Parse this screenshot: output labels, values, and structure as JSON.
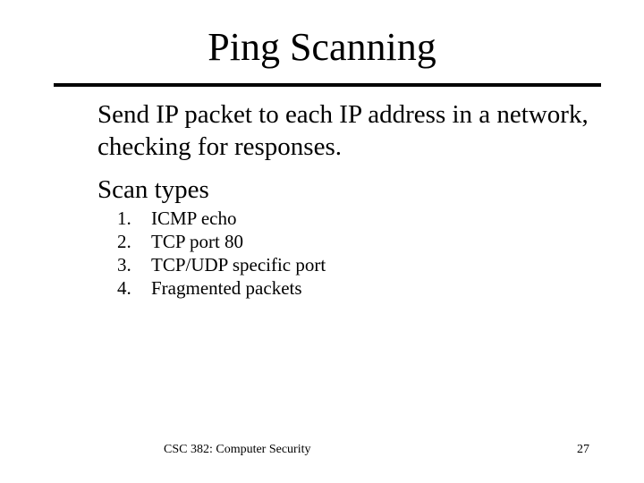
{
  "slide": {
    "title": "Ping Scanning",
    "paragraphs": [
      "Send IP packet to each IP address in a network, checking for responses.",
      "Scan types"
    ],
    "scan_types": [
      {
        "num": "1.",
        "label": "ICMP echo"
      },
      {
        "num": "2.",
        "label": "TCP port 80"
      },
      {
        "num": "3.",
        "label": "TCP/UDP specific port"
      },
      {
        "num": "4.",
        "label": "Fragmented packets"
      }
    ],
    "footer": {
      "course": "CSC 382: Computer Security",
      "page_number": "27"
    }
  }
}
